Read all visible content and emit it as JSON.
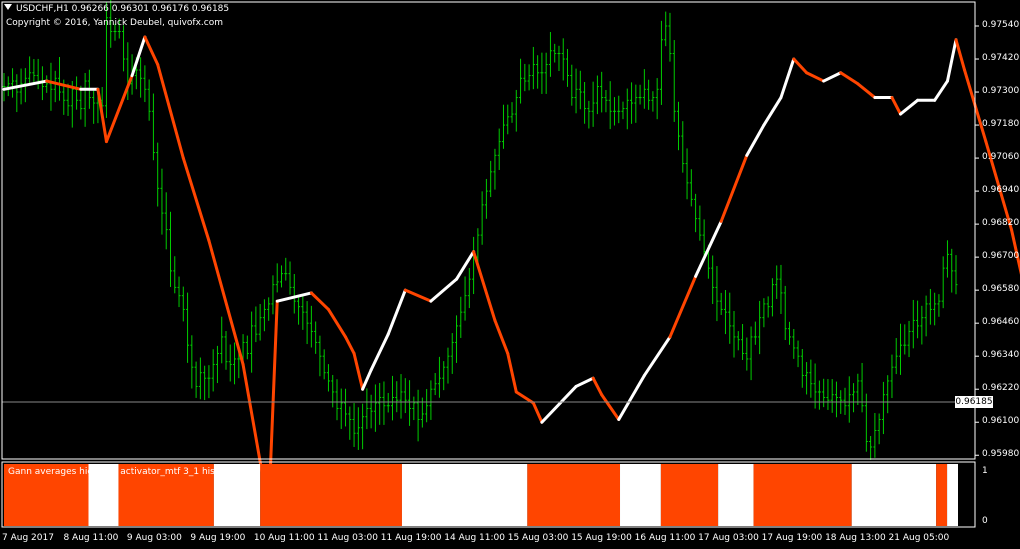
{
  "header": {
    "symbol_info": "USDCHF,H1  0.96266 0.96301 0.96176 0.96185",
    "copyright": "Copyright © 2016, Yannick Deubel, quivofx.com"
  },
  "indicator": {
    "name": "Gann averages high-low activator_mtf 3_1 histo 1.0000",
    "scale_labels": [
      "1",
      "0"
    ]
  },
  "current_price": "0.96185",
  "colors": {
    "background": "#000000",
    "candles": "#00cc00",
    "down_line": "#ff4500",
    "up_line": "#ffffff",
    "histogram_down": "#ff4500",
    "histogram_up": "#ffffff",
    "axis": "#ffffff"
  },
  "chart_data": {
    "type": "line",
    "symbol": "USDCHF",
    "timeframe": "H1",
    "ohlc_last": {
      "open": 0.96266,
      "high": 0.96301,
      "low": 0.96176,
      "close": 0.96185
    },
    "price_axis_ticks": [
      "0.97540",
      "0.97420",
      "0.97300",
      "0.97180",
      "0.97060",
      "0.96940",
      "0.96820",
      "0.96700",
      "0.96580",
      "0.96460",
      "0.96340",
      "0.96220",
      "0.96100",
      "0.95980"
    ],
    "time_axis_ticks": [
      "7 Aug 2017",
      "8 Aug 11:00",
      "9 Aug 03:00",
      "9 Aug 19:00",
      "10 Aug 11:00",
      "11 Aug 03:00",
      "11 Aug 19:00",
      "14 Aug 11:00",
      "15 Aug 03:00",
      "15 Aug 19:00",
      "16 Aug 11:00",
      "17 Aug 03:00",
      "17 Aug 19:00",
      "18 Aug 13:00",
      "21 Aug 05:00"
    ],
    "ylim": [
      0.9597,
      0.9762
    ],
    "bar_count": 246,
    "price_series": [
      0.9732,
      0.9733,
      0.9734,
      0.973,
      0.9733,
      0.9735,
      0.9737,
      0.9736,
      0.9734,
      0.9732,
      0.9733,
      0.9731,
      0.9735,
      0.973,
      0.9727,
      0.9725,
      0.9731,
      0.9727,
      0.9724,
      0.9734,
      0.9728,
      0.9726,
      0.9727,
      0.9725,
      0.9757,
      0.9752,
      0.9752,
      0.9752,
      0.9742,
      0.9733,
      0.9736,
      0.9738,
      0.9735,
      0.9731,
      0.9723,
      0.9708,
      0.9695,
      0.9686,
      0.968,
      0.9665,
      0.9659,
      0.9656,
      0.9651,
      0.9638,
      0.963,
      0.9623,
      0.9628,
      0.9626,
      0.9626,
      0.9631,
      0.9635,
      0.9641,
      0.9632,
      0.9631,
      0.9633,
      0.9633,
      0.9639,
      0.9635,
      0.9645,
      0.9642,
      0.9648,
      0.9651,
      0.9653,
      0.966,
      0.9661,
      0.9664,
      0.9664,
      0.9659,
      0.9654,
      0.9652,
      0.965,
      0.9646,
      0.9643,
      0.9639,
      0.9634,
      0.9628,
      0.9625,
      0.9621,
      0.9615,
      0.9617,
      0.9613,
      0.9611,
      0.9606,
      0.9608,
      0.9612,
      0.9615,
      0.9614,
      0.9617,
      0.9619,
      0.9616,
      0.9616,
      0.9619,
      0.9618,
      0.9621,
      0.9618,
      0.9615,
      0.9617,
      0.9611,
      0.9613,
      0.9616,
      0.9622,
      0.9624,
      0.9626,
      0.963,
      0.9634,
      0.9639,
      0.9645,
      0.965,
      0.9656,
      0.9662,
      0.967,
      0.9678,
      0.9689,
      0.9694,
      0.9701,
      0.9707,
      0.9712,
      0.9718,
      0.9721,
      0.9722,
      0.9728,
      0.9735,
      0.9734,
      0.9736,
      0.974,
      0.9737,
      0.9737,
      0.974,
      0.9745,
      0.9744,
      0.9744,
      0.9742,
      0.9736,
      0.9728,
      0.9731,
      0.973,
      0.9724,
      0.9723,
      0.9726,
      0.9732,
      0.9728,
      0.9727,
      0.9723,
      0.9723,
      0.9723,
      0.9724,
      0.9727,
      0.9726,
      0.9728,
      0.9728,
      0.9731,
      0.9727,
      0.9728,
      0.9731,
      0.9749,
      0.9754,
      0.9744,
      0.9723,
      0.9714,
      0.9704,
      0.9697,
      0.9691,
      0.9684,
      0.9678,
      0.9672,
      0.9666,
      0.9659,
      0.9654,
      0.9651,
      0.965,
      0.9645,
      0.9641,
      0.964,
      0.9635,
      0.9633,
      0.9641,
      0.9641,
      0.9648,
      0.9653,
      0.9652,
      0.966,
      0.9662,
      0.9657,
      0.9644,
      0.9641,
      0.9637,
      0.9634,
      0.9627,
      0.9628,
      0.9624,
      0.9621,
      0.9621,
      0.9619,
      0.9618,
      0.962,
      0.9619,
      0.9618,
      0.9616,
      0.962,
      0.9621,
      0.9625,
      0.9616,
      0.9603,
      0.9601,
      0.9607,
      0.9611,
      0.962,
      0.9625,
      0.963,
      0.9634,
      0.9638,
      0.9638,
      0.9643,
      0.9647,
      0.9645,
      0.9648,
      0.9653,
      0.9651,
      0.9653,
      0.9654,
      0.9666,
      0.9671,
      0.9665,
      0.966
    ],
    "activator_line": [
      [
        0,
        0.9731
      ],
      [
        10,
        0.9734
      ],
      [
        18,
        0.9731
      ],
      [
        22,
        0.9731
      ],
      [
        24,
        0.9712
      ],
      [
        30,
        0.9736
      ],
      [
        33,
        0.975
      ],
      [
        36,
        0.974
      ],
      [
        42,
        0.9706
      ],
      [
        48,
        0.9676
      ],
      [
        56,
        0.9631
      ],
      [
        62,
        0.9578
      ],
      [
        64,
        0.9654
      ],
      [
        72,
        0.9657
      ],
      [
        76,
        0.9651
      ],
      [
        80,
        0.9641
      ],
      [
        82,
        0.9635
      ],
      [
        84,
        0.9622
      ],
      [
        86,
        0.9629
      ],
      [
        90,
        0.9642
      ],
      [
        94,
        0.9658
      ],
      [
        100,
        0.9654
      ],
      [
        106,
        0.9662
      ],
      [
        110,
        0.9672
      ],
      [
        115,
        0.9647
      ],
      [
        118,
        0.9635
      ],
      [
        120,
        0.9621
      ],
      [
        124,
        0.9617
      ],
      [
        126,
        0.961
      ],
      [
        134,
        0.9623
      ],
      [
        138,
        0.9626
      ],
      [
        140,
        0.962
      ],
      [
        144,
        0.9611
      ],
      [
        150,
        0.9627
      ],
      [
        156,
        0.9641
      ],
      [
        162,
        0.9663
      ],
      [
        168,
        0.9683
      ],
      [
        174,
        0.9707
      ],
      [
        178,
        0.9718
      ],
      [
        182,
        0.9728
      ],
      [
        185,
        0.9742
      ],
      [
        188,
        0.9737
      ],
      [
        192,
        0.9734
      ],
      [
        196,
        0.9737
      ],
      [
        200,
        0.9733
      ],
      [
        204,
        0.9728
      ],
      [
        208,
        0.9728
      ],
      [
        210,
        0.9722
      ],
      [
        214,
        0.9727
      ],
      [
        218,
        0.9727
      ],
      [
        221,
        0.9734
      ],
      [
        223,
        0.9749
      ],
      [
        225,
        0.9738
      ],
      [
        230,
        0.9712
      ],
      [
        236,
        0.968
      ],
      [
        240,
        0.9652
      ],
      [
        245,
        0.9642
      ]
    ],
    "histogram_segments": [
      {
        "start": 0,
        "end": 31,
        "value": 1
      },
      {
        "start": 31,
        "end": 42,
        "value": 0
      },
      {
        "start": 42,
        "end": 77,
        "value": 1
      },
      {
        "start": 77,
        "end": 94,
        "value": 0
      },
      {
        "start": 94,
        "end": 146,
        "value": 1
      },
      {
        "start": 146,
        "end": 192,
        "value": 0
      },
      {
        "start": 192,
        "end": 226,
        "value": 1
      },
      {
        "start": 226,
        "end": 241,
        "value": 0
      },
      {
        "start": 241,
        "end": 262,
        "value": 1
      },
      {
        "start": 262,
        "end": 275,
        "value": 0
      },
      {
        "start": 275,
        "end": 311,
        "value": 1
      },
      {
        "start": 311,
        "end": 342,
        "value": 0
      },
      {
        "start": 342,
        "end": 346,
        "value": 1
      },
      {
        "start": 346,
        "end": 350,
        "value": 0
      }
    ]
  }
}
